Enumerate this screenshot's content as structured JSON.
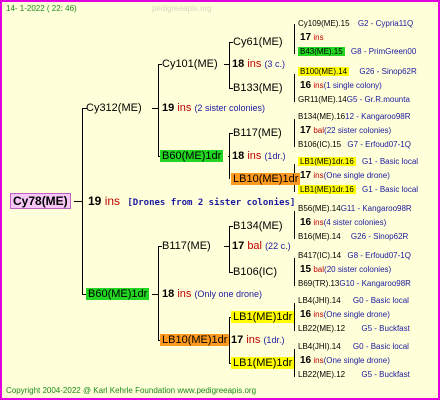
{
  "header": {
    "date": "14-  1-2022 ( 22: 46)",
    "watermark": "pedigreeapis.org"
  },
  "root": {
    "label": "Cy78(ME)",
    "year": "19",
    "ins": "ins",
    "note": "[Drones from 2 sister colonies]"
  },
  "gen1": [
    {
      "label": "Cy312(ME)",
      "year": "19",
      "ins": "ins",
      "note": "(2 sister colonies)"
    },
    {
      "label": "B60(ME)1dr",
      "year": "18",
      "ins": "ins",
      "note": "(Only one drone)"
    }
  ],
  "gen2": [
    {
      "label": "Cy101(ME)",
      "year": "18",
      "ins": "ins",
      "note": "(3 c.)"
    },
    {
      "label": "B60(ME)1dr",
      "year": "18",
      "ins": "ins",
      "note": "(1dr.)"
    },
    {
      "label": "B117(ME)",
      "year": "17",
      "ins": "bal",
      "note": "(22 c.)"
    },
    {
      "label": "LB10(ME)1dr",
      "year": "17",
      "ins": "ins",
      "note": "(1dr.)"
    }
  ],
  "gen3": [
    {
      "label": "Cy61(ME)"
    },
    {
      "label": "B133(ME)"
    },
    {
      "label": "B117(ME)"
    },
    {
      "label": "LB10(ME)1dr"
    },
    {
      "label": "B134(ME)"
    },
    {
      "label": "B106(IC)"
    },
    {
      "label": "LB1(ME)1dr"
    },
    {
      "label": "LB1(ME)1dr"
    }
  ],
  "gen4": [
    {
      "line1": "Cy109(ME).15",
      "code": "G2 - Cypria11Q",
      "year": "17",
      "ins": "ins",
      "note": ""
    },
    {
      "line1": "B43(ME).15",
      "code": "G8 - PrimGreen00",
      "year": "",
      "ins": "",
      "note": ""
    },
    {
      "line1": "B100(ME).14",
      "code": "G26 - Sinop62R",
      "year": "16",
      "ins": "ins",
      "note": "(1 single colony)"
    },
    {
      "line1": "GR11(ME).14",
      "code": "G5 - Gr.R.mounta",
      "year": "",
      "ins": "",
      "note": ""
    },
    {
      "line1": "B134(ME).16",
      "code": "12 - Kangaroo98R",
      "year": "17",
      "ins": "bal",
      "note": "(22 sister colonies)"
    },
    {
      "line1": "B106(IC).15",
      "code": "G7 - Erfoud07-1Q",
      "year": "",
      "ins": "",
      "note": ""
    },
    {
      "line1": "LB1(ME)1dr.16",
      "code": "G1 - Basic local",
      "year": "17",
      "ins": "ins",
      "note": "(One single drone)"
    },
    {
      "line1": "LB1(ME)1dr.16",
      "code": "G1 - Basic local",
      "year": "",
      "ins": "",
      "note": ""
    },
    {
      "line1": "B56(ME).14",
      "code": "G11 - Kangaroo98R",
      "year": "16",
      "ins": "ins",
      "note": "(4 sister colonies)"
    },
    {
      "line1": "B16(ME).14",
      "code": "G26 - Sinop62R",
      "year": "",
      "ins": "",
      "note": ""
    },
    {
      "line1": "B417(IC).14",
      "code": "G8 - Erfoud07-1Q",
      "year": "15",
      "ins": "bal",
      "note": "(20 sister colonies)"
    },
    {
      "line1": "B69(TR).13",
      "code": "G10 - Kangaroo98R",
      "year": "",
      "ins": "",
      "note": ""
    },
    {
      "line1": "LB4(JHI).14",
      "code": "G0 - Basic local",
      "year": "16",
      "ins": "ins",
      "note": "(One single drone)"
    },
    {
      "line1": "LB22(ME).12",
      "code": "G5 - Buckfast",
      "year": "",
      "ins": "",
      "note": ""
    },
    {
      "line1": "LB4(JHI).14",
      "code": "G0 - Basic local",
      "year": "16",
      "ins": "ins",
      "note": "(One single drone)"
    },
    {
      "line1": "LB22(ME).12",
      "code": "G5 - Buckfast",
      "year": "",
      "ins": "",
      "note": ""
    }
  ],
  "footer": {
    "text": "Copyright 2004-2022 @ Karl Kehrle Foundation    www.pedigreeapis.org"
  },
  "colors": {
    "border": "#e000e0",
    "background": "#ffffd9",
    "green": "#22d622",
    "yellow": "#ffff00",
    "orange": "#ff9a20",
    "pink": "#f7c8f7"
  }
}
